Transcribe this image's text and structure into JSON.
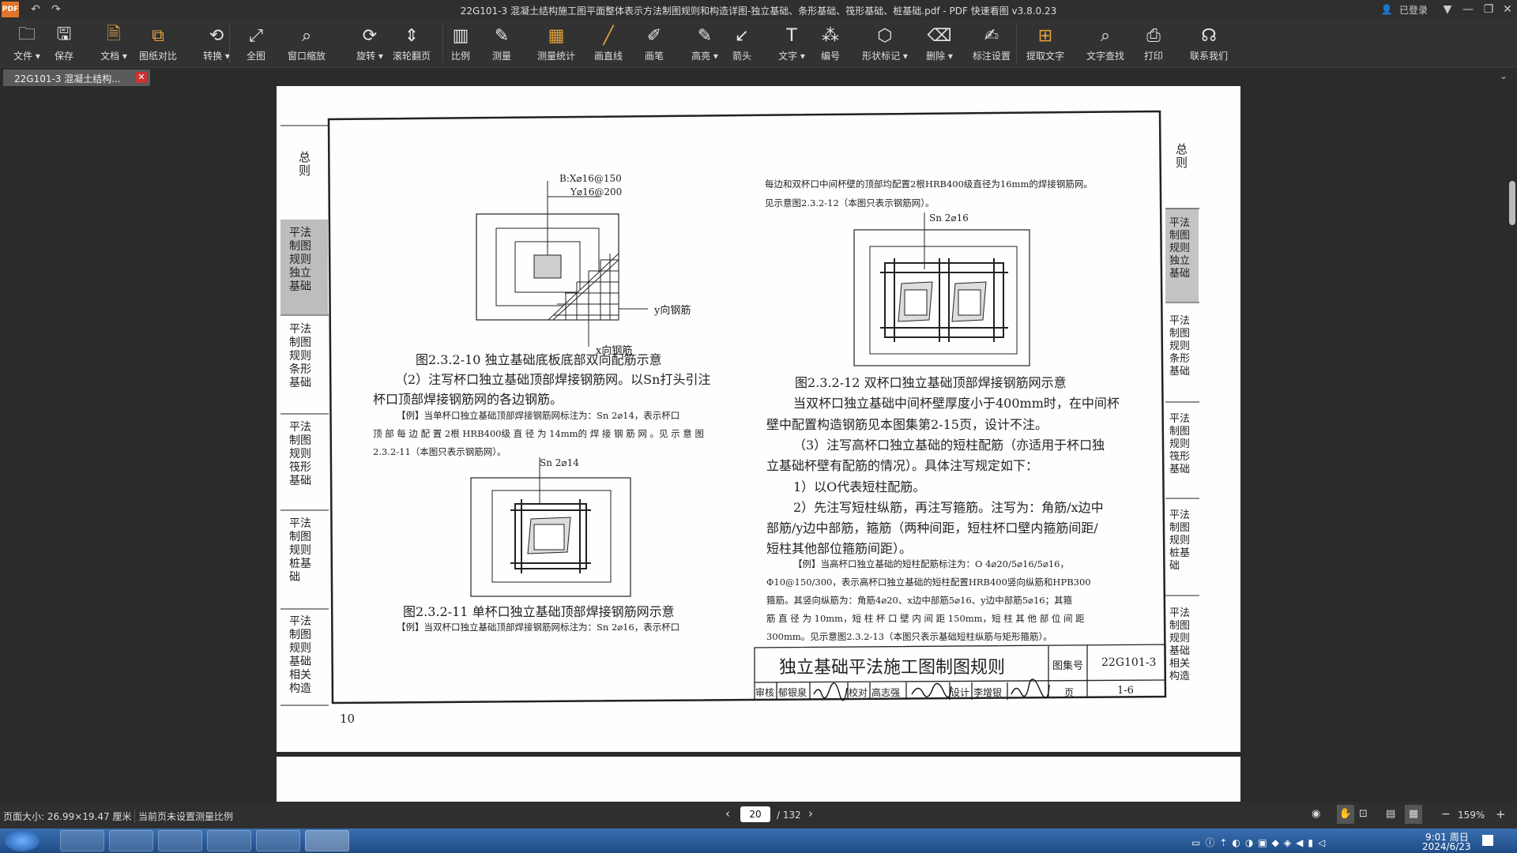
{
  "window": {
    "title": "22G101-3 混凝土结构施工图平面整体表示方法制图规则和构造详图-独立基础、条形基础、筏形基础、桩基础.pdf - PDF 快速看图 v3.8.0.23",
    "login_label": "已登录"
  },
  "toolbar": {
    "items": [
      {
        "label": "文件",
        "icon": "folder-icon"
      },
      {
        "label": "保存",
        "icon": "save-icon"
      },
      {
        "label": "文档",
        "icon": "document-icon"
      },
      {
        "label": "图纸对比",
        "icon": "compare-icon"
      },
      {
        "label": "转换",
        "icon": "convert-icon"
      },
      {
        "label": "全图",
        "icon": "fit-page-icon"
      },
      {
        "label": "窗口缩放",
        "icon": "zoom-window-icon"
      },
      {
        "label": "旋转",
        "icon": "rotate-icon"
      },
      {
        "label": "滚轮翻页",
        "icon": "scroll-page-icon"
      },
      {
        "label": "比例",
        "icon": "scale-icon"
      },
      {
        "label": "测量",
        "icon": "measure-icon"
      },
      {
        "label": "测量统计",
        "icon": "measure-stats-icon"
      },
      {
        "label": "画直线",
        "icon": "line-icon"
      },
      {
        "label": "画笔",
        "icon": "pen-icon"
      },
      {
        "label": "高亮",
        "icon": "highlight-icon"
      },
      {
        "label": "箭头",
        "icon": "arrow-icon"
      },
      {
        "label": "文字",
        "icon": "text-icon"
      },
      {
        "label": "编号",
        "icon": "number-icon"
      },
      {
        "label": "形状标记",
        "icon": "shape-mark-icon"
      },
      {
        "label": "删除",
        "icon": "eraser-icon"
      },
      {
        "label": "标注设置",
        "icon": "annotation-settings-icon"
      },
      {
        "label": "提取文字",
        "icon": "extract-text-icon"
      },
      {
        "label": "文字查找",
        "icon": "search-icon"
      },
      {
        "label": "打印",
        "icon": "print-icon"
      },
      {
        "label": "联系我们",
        "icon": "headset-icon"
      }
    ]
  },
  "tab": {
    "label": "22G101-3 混凝土结构..."
  },
  "document": {
    "left_tabs": [
      "总则",
      "平法制图规则 独立基础",
      "平法制图规则 条形基础",
      "平法制图规则 筏形基础",
      "平法制图规则 桩基础",
      "平法制图规则 基础相关构造"
    ],
    "right_tabs": [
      "总则",
      "平法制图规则 独立基础",
      "平法制图规则 条形基础",
      "平法制图规则 筏形基础",
      "平法制图规则 桩基础",
      "平法制图规则 基础相关构造"
    ],
    "fig10_label_b": "B:X⌀16@150",
    "fig10_label_y": "Y⌀16@200",
    "fig10_y_bar": "y向钢筋",
    "fig10_x_bar": "x向钢筋",
    "fig10_caption": "图2.3.2-10 独立基础底板底部双向配筋示意",
    "para2_line1": "（2）注写杯口独立基础顶部焊接钢筋网。以Sn打头引注",
    "para2_line2": "杯口顶部焊接钢筋网的各边钢筋。",
    "ex1_line1": "【例】当单杯口独立基础顶部焊接钢筋网标注为：Sn 2⌀14，表示杯口",
    "ex1_line2": "顶 部 每 边 配 置 2根 HRB400级 直 径 为 14mm的 焊 接 钢 筋 网 。见 示 意 图",
    "ex1_line3": "2.3.2-11（本图只表示钢筋网）。",
    "fig11_label": "Sn 2⌀14",
    "fig11_caption": "图2.3.2-11 单杯口独立基础顶部焊接钢筋网示意",
    "ex2_line1": "【例】当双杯口独立基础顶部焊接钢筋网标注为：Sn 2⌀16，表示杯口",
    "right_top_line1": "每边和双杯口中间杯壁的顶部均配置2根HRB400级直径为16mm的焊接钢筋网。",
    "right_top_line2": "见示意图2.3.2-12（本图只表示钢筋网）。",
    "fig12_label": "Sn 2⌀16",
    "fig12_caption": "图2.3.2-12 双杯口独立基础顶部焊接钢筋网示意",
    "r_line1": "当双杯口独立基础中间杯壁厚度小于400mm时，在中间杯",
    "r_line2": "壁中配置构造钢筋见本图集第2-15页，设计不注。",
    "r_line3": "（3）注写高杯口独立基础的短柱配筋（亦适用于杯口独",
    "r_line4": "立基础杯壁有配筋的情况）。具体注写规定如下：",
    "r_line5": "1）以O代表短柱配筋。",
    "r_line6": "2）先注写短柱纵筋，再注写箍筋。注写为：角筋/x边中",
    "r_line7": "部筋/y边中部筋，箍筋（两种间距，短柱杯口壁内箍筋间距/",
    "r_line8": "短柱其他部位箍筋间距）。",
    "ex3_line1": "【例】当高杯口独立基础的短柱配筋标注为：O 4⌀20/5⌀16/5⌀16，",
    "ex3_line2": "Φ10@150/300，表示高杯口独立基础的短柱配置HRB400竖向纵筋和HPB300",
    "ex3_line3": "箍筋。其竖向纵筋为：角筋4⌀20、x边中部筋5⌀16、y边中部筋5⌀16；其箍",
    "ex3_line4": "筋 直 径 为 10mm，短 柱 杯 口 壁 内 间 距 150mm，短 柱 其 他 部 位 间 距",
    "ex3_line5": "300mm。见示意图2.3.2-13（本图只表示基础短柱纵筋与矩形箍筋）。",
    "title_block": {
      "title": "独立基础平法施工图制图规则",
      "atlas_label": "图集号",
      "atlas_no": "22G101-3",
      "review": "审核",
      "reviewer": "郁银泉",
      "check": "校对",
      "checker": "高志强",
      "design": "设计",
      "designer": "李增银",
      "page_label": "页",
      "page_no": "1-6"
    },
    "page_number": "10"
  },
  "status": {
    "page_size": "页面大小: 26.99×19.47 厘米",
    "scale_note": "当前页未设置测量比例",
    "current_page": "20",
    "total_pages": "/ 132",
    "zoom": "159%"
  },
  "taskbar": {
    "time": "9:01 周日",
    "date": "2024/6/23"
  }
}
